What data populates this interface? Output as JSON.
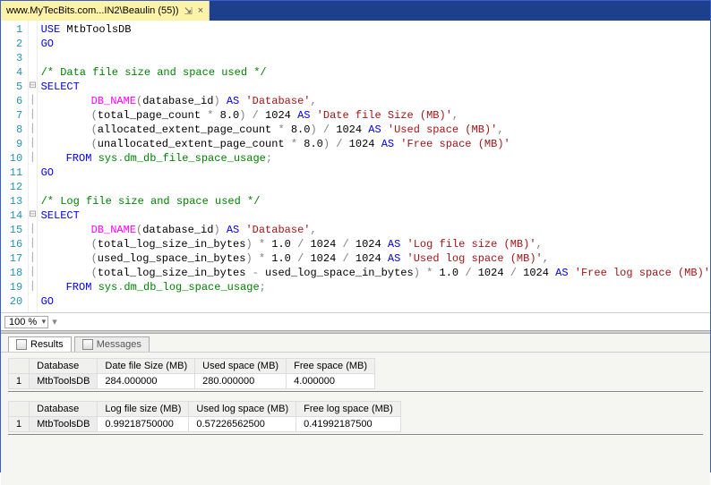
{
  "tab": {
    "title": "www.MyTecBits.com...IN2\\Beaulin (55))",
    "pin_glyph": "⇲",
    "close_glyph": "×"
  },
  "lines": {
    "l1": {
      "ind": 0,
      "t": [
        [
          "kw",
          "USE"
        ],
        [
          "sp",
          " "
        ],
        [
          "id",
          "MtbToolsDB"
        ]
      ]
    },
    "l2": {
      "ind": 0,
      "t": [
        [
          "kw",
          "GO"
        ]
      ]
    },
    "l3": {
      "ind": 0,
      "t": []
    },
    "l4": {
      "ind": 0,
      "t": [
        [
          "com",
          "/* Data file size and space used */"
        ]
      ]
    },
    "l5": {
      "ind": 0,
      "fold": "-",
      "t": [
        [
          "kw",
          "SELECT"
        ]
      ]
    },
    "l6": {
      "ind": 2,
      "t": [
        [
          "fn",
          "DB_NAME"
        ],
        [
          "op",
          "("
        ],
        [
          "id",
          "database_id"
        ],
        [
          "op",
          ")"
        ],
        [
          "sp",
          " "
        ],
        [
          "kw",
          "AS"
        ],
        [
          "sp",
          " "
        ],
        [
          "str",
          "'Database'"
        ],
        [
          "op",
          ","
        ]
      ]
    },
    "l7": {
      "ind": 2,
      "t": [
        [
          "op",
          "("
        ],
        [
          "id",
          "total_page_count"
        ],
        [
          "sp",
          " "
        ],
        [
          "op",
          "*"
        ],
        [
          "sp",
          " "
        ],
        [
          "num",
          "8.0"
        ],
        [
          "op",
          ")"
        ],
        [
          "sp",
          " "
        ],
        [
          "op",
          "/"
        ],
        [
          "sp",
          " "
        ],
        [
          "num",
          "1024"
        ],
        [
          "sp",
          " "
        ],
        [
          "kw",
          "AS"
        ],
        [
          "sp",
          " "
        ],
        [
          "str",
          "'Date file Size (MB)'"
        ],
        [
          "op",
          ","
        ]
      ]
    },
    "l8": {
      "ind": 2,
      "t": [
        [
          "op",
          "("
        ],
        [
          "id",
          "allocated_extent_page_count"
        ],
        [
          "sp",
          " "
        ],
        [
          "op",
          "*"
        ],
        [
          "sp",
          " "
        ],
        [
          "num",
          "8.0"
        ],
        [
          "op",
          ")"
        ],
        [
          "sp",
          " "
        ],
        [
          "op",
          "/"
        ],
        [
          "sp",
          " "
        ],
        [
          "num",
          "1024"
        ],
        [
          "sp",
          " "
        ],
        [
          "kw",
          "AS"
        ],
        [
          "sp",
          " "
        ],
        [
          "str",
          "'Used space (MB)'"
        ],
        [
          "op",
          ","
        ]
      ]
    },
    "l9": {
      "ind": 2,
      "t": [
        [
          "op",
          "("
        ],
        [
          "id",
          "unallocated_extent_page_count"
        ],
        [
          "sp",
          " "
        ],
        [
          "op",
          "*"
        ],
        [
          "sp",
          " "
        ],
        [
          "num",
          "8.0"
        ],
        [
          "op",
          ")"
        ],
        [
          "sp",
          " "
        ],
        [
          "op",
          "/"
        ],
        [
          "sp",
          " "
        ],
        [
          "num",
          "1024"
        ],
        [
          "sp",
          " "
        ],
        [
          "kw",
          "AS"
        ],
        [
          "sp",
          " "
        ],
        [
          "str",
          "'Free space (MB)'"
        ]
      ]
    },
    "l10": {
      "ind": 1,
      "t": [
        [
          "kw",
          "FROM"
        ],
        [
          "sp",
          " "
        ],
        [
          "sys",
          "sys"
        ],
        [
          "op",
          "."
        ],
        [
          "sys",
          "dm_db_file_space_usage"
        ],
        [
          "op",
          ";"
        ]
      ]
    },
    "l11": {
      "ind": 0,
      "t": [
        [
          "kw",
          "GO"
        ]
      ]
    },
    "l12": {
      "ind": 0,
      "t": []
    },
    "l13": {
      "ind": 0,
      "t": [
        [
          "com",
          "/* Log file size and space used */"
        ]
      ]
    },
    "l14": {
      "ind": 0,
      "fold": "-",
      "t": [
        [
          "kw",
          "SELECT"
        ]
      ]
    },
    "l15": {
      "ind": 2,
      "t": [
        [
          "fn",
          "DB_NAME"
        ],
        [
          "op",
          "("
        ],
        [
          "id",
          "database_id"
        ],
        [
          "op",
          ")"
        ],
        [
          "sp",
          " "
        ],
        [
          "kw",
          "AS"
        ],
        [
          "sp",
          " "
        ],
        [
          "str",
          "'Database'"
        ],
        [
          "op",
          ","
        ]
      ]
    },
    "l16": {
      "ind": 2,
      "t": [
        [
          "op",
          "("
        ],
        [
          "id",
          "total_log_size_in_bytes"
        ],
        [
          "op",
          ")"
        ],
        [
          "sp",
          " "
        ],
        [
          "op",
          "*"
        ],
        [
          "sp",
          " "
        ],
        [
          "num",
          "1.0"
        ],
        [
          "sp",
          " "
        ],
        [
          "op",
          "/"
        ],
        [
          "sp",
          " "
        ],
        [
          "num",
          "1024"
        ],
        [
          "sp",
          " "
        ],
        [
          "op",
          "/"
        ],
        [
          "sp",
          " "
        ],
        [
          "num",
          "1024"
        ],
        [
          "sp",
          " "
        ],
        [
          "kw",
          "AS"
        ],
        [
          "sp",
          " "
        ],
        [
          "str",
          "'Log file size (MB)'"
        ],
        [
          "op",
          ","
        ]
      ]
    },
    "l17": {
      "ind": 2,
      "t": [
        [
          "op",
          "("
        ],
        [
          "id",
          "used_log_space_in_bytes"
        ],
        [
          "op",
          ")"
        ],
        [
          "sp",
          " "
        ],
        [
          "op",
          "*"
        ],
        [
          "sp",
          " "
        ],
        [
          "num",
          "1.0"
        ],
        [
          "sp",
          " "
        ],
        [
          "op",
          "/"
        ],
        [
          "sp",
          " "
        ],
        [
          "num",
          "1024"
        ],
        [
          "sp",
          " "
        ],
        [
          "op",
          "/"
        ],
        [
          "sp",
          " "
        ],
        [
          "num",
          "1024"
        ],
        [
          "sp",
          " "
        ],
        [
          "kw",
          "AS"
        ],
        [
          "sp",
          " "
        ],
        [
          "str",
          "'Used log space (MB)'"
        ],
        [
          "op",
          ","
        ]
      ]
    },
    "l18": {
      "ind": 2,
      "t": [
        [
          "op",
          "("
        ],
        [
          "id",
          "total_log_size_in_bytes"
        ],
        [
          "sp",
          " "
        ],
        [
          "op",
          "-"
        ],
        [
          "sp",
          " "
        ],
        [
          "id",
          "used_log_space_in_bytes"
        ],
        [
          "op",
          ")"
        ],
        [
          "sp",
          " "
        ],
        [
          "op",
          "*"
        ],
        [
          "sp",
          " "
        ],
        [
          "num",
          "1.0"
        ],
        [
          "sp",
          " "
        ],
        [
          "op",
          "/"
        ],
        [
          "sp",
          " "
        ],
        [
          "num",
          "1024"
        ],
        [
          "sp",
          " "
        ],
        [
          "op",
          "/"
        ],
        [
          "sp",
          " "
        ],
        [
          "num",
          "1024"
        ],
        [
          "sp",
          " "
        ],
        [
          "kw",
          "AS"
        ],
        [
          "sp",
          " "
        ],
        [
          "str",
          "'Free log space (MB)'"
        ]
      ]
    },
    "l19": {
      "ind": 1,
      "t": [
        [
          "kw",
          "FROM"
        ],
        [
          "sp",
          " "
        ],
        [
          "sys",
          "sys"
        ],
        [
          "op",
          "."
        ],
        [
          "sys",
          "dm_db_log_space_usage"
        ],
        [
          "op",
          ";"
        ]
      ]
    },
    "l20": {
      "ind": 0,
      "t": [
        [
          "kw",
          "GO"
        ]
      ]
    }
  },
  "line_count": 20,
  "zoom": "100 %",
  "result_tabs": {
    "results": "Results",
    "messages": "Messages"
  },
  "grid1": {
    "headers": [
      "",
      "Database",
      "Date file Size (MB)",
      "Used space (MB)",
      "Free space (MB)"
    ],
    "rows": [
      [
        "1",
        "MtbToolsDB",
        "284.000000",
        "280.000000",
        "4.000000"
      ]
    ]
  },
  "grid2": {
    "headers": [
      "",
      "Database",
      "Log file size (MB)",
      "Used log space (MB)",
      "Free log space (MB)"
    ],
    "rows": [
      [
        "1",
        "MtbToolsDB",
        "0.99218750000",
        "0.57226562500",
        "0.41992187500"
      ]
    ]
  }
}
